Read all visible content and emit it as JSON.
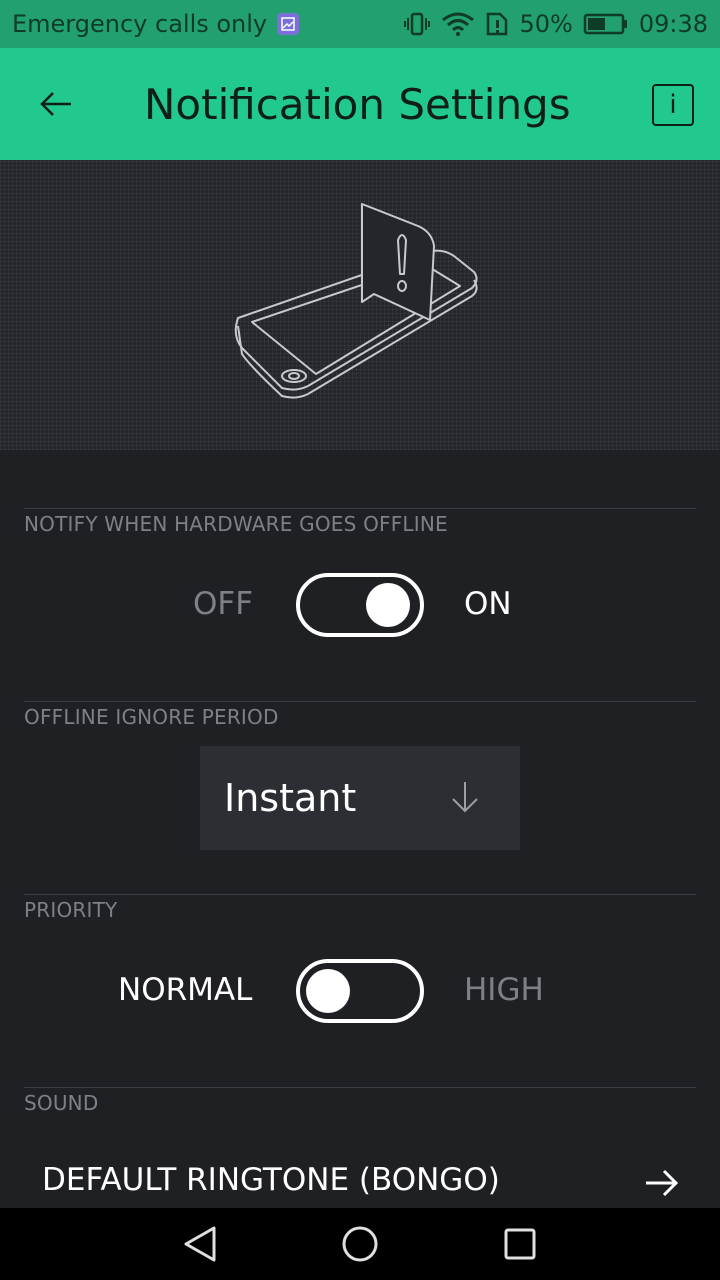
{
  "status_bar": {
    "carrier_text": "Emergency calls only",
    "battery": "50%",
    "time": "09:38"
  },
  "app_bar": {
    "title": "Notification Settings",
    "info_label": "i"
  },
  "sections": {
    "offline_notify": {
      "label": "NOTIFY WHEN HARDWARE GOES OFFLINE",
      "off_label": "OFF",
      "on_label": "ON",
      "state": "ON"
    },
    "ignore_period": {
      "label": "OFFLINE IGNORE PERIOD",
      "value": "Instant"
    },
    "priority": {
      "label": "PRIORITY",
      "left_label": "NORMAL",
      "right_label": "HIGH",
      "state": "NORMAL"
    },
    "sound": {
      "label": "SOUND",
      "value": "DEFAULT RINGTONE (BONGO)"
    }
  },
  "colors": {
    "accent": "#22c98e",
    "status_bar": "#23a06f",
    "background": "#1f2024",
    "inactive_text": "#7e8087"
  }
}
